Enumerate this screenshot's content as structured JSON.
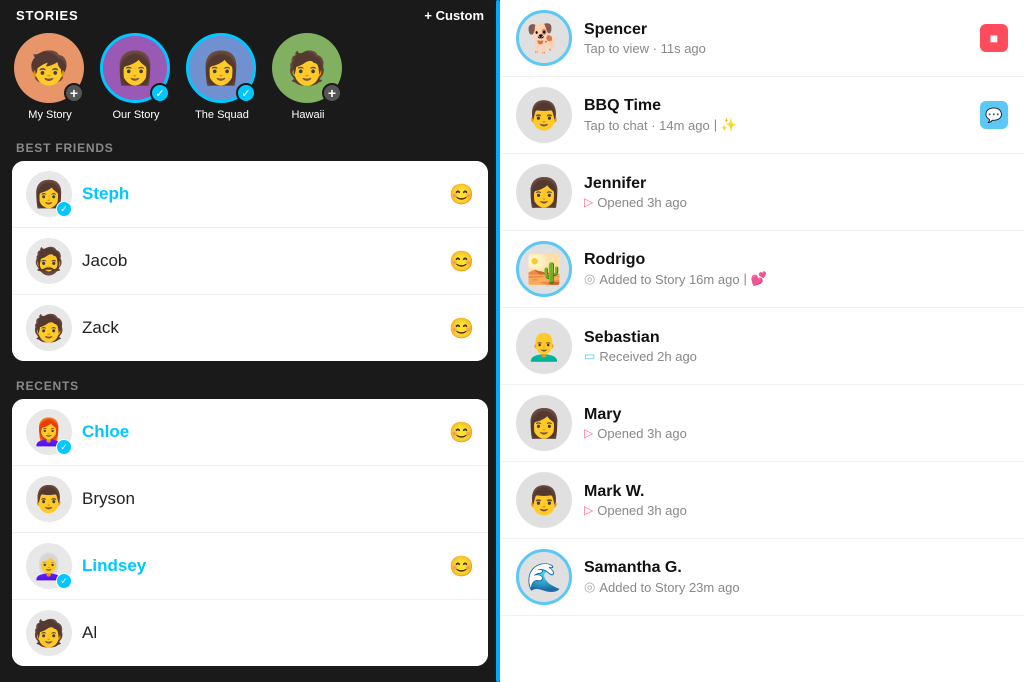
{
  "left": {
    "stories_title": "STORIES",
    "custom_label": "+ Custom",
    "stories": [
      {
        "id": "my-story",
        "label": "My Story",
        "emoji": "🧒",
        "has_ring": false,
        "has_add": true,
        "bg": "av-my-story"
      },
      {
        "id": "our-story",
        "label": "Our Story",
        "emoji": "👩",
        "has_ring": true,
        "has_check": true,
        "bg": "av-our-story"
      },
      {
        "id": "squad",
        "label": "The Squad",
        "emoji": "👩‍🦱",
        "has_ring": true,
        "has_check": true,
        "bg": "av-squad"
      },
      {
        "id": "hawaii",
        "label": "Hawaii",
        "emoji": "🧑",
        "has_ring": false,
        "has_add": true,
        "bg": "av-hawaii"
      }
    ],
    "best_friends_label": "BEST FRIENDS",
    "best_friends": [
      {
        "name": "Steph",
        "emoji": "👩",
        "selected": true,
        "has_check": true,
        "badge": "😊"
      },
      {
        "name": "Jacob",
        "emoji": "🧔",
        "selected": false,
        "has_check": false,
        "badge": "😊"
      },
      {
        "name": "Zack",
        "emoji": "🧑",
        "selected": false,
        "has_check": false,
        "badge": "😊"
      }
    ],
    "recents_label": "RECENTS",
    "recents": [
      {
        "name": "Chloe",
        "emoji": "👩‍🦰",
        "selected": true,
        "has_check": true,
        "badge": "😊"
      },
      {
        "name": "Bryson",
        "emoji": "👨",
        "selected": false,
        "has_check": false,
        "badge": null
      },
      {
        "name": "Lindsey",
        "emoji": "👩‍🦳",
        "selected": true,
        "has_check": true,
        "badge": "😊"
      },
      {
        "name": "Al",
        "emoji": "🧑",
        "selected": false,
        "has_check": false,
        "badge": null
      }
    ]
  },
  "right": {
    "chats": [
      {
        "name": "Spencer",
        "sub": "Tap to view · 11s ago",
        "sub_type": "gray",
        "emoji": "🐕",
        "ring": "blue",
        "badge_type": "red",
        "badge_icon": "■"
      },
      {
        "name": "BBQ Time",
        "sub": "Tap to chat · 14m ago",
        "sub_extra": "✨",
        "sub_type": "gray",
        "emoji": "🧑",
        "ring": "none",
        "badge_type": "blue",
        "badge_icon": "💬"
      },
      {
        "name": "Jennifer",
        "sub": "Opened 3h ago",
        "sub_type": "pink",
        "emoji": "👩",
        "ring": "none",
        "badge_type": "none",
        "badge_icon": ""
      },
      {
        "name": "Rodrigo",
        "sub": "Added to Story 16m ago",
        "sub_extra": "💕",
        "sub_type": "gray-ring",
        "emoji": "🏜️",
        "ring": "blue",
        "badge_type": "none",
        "badge_icon": ""
      },
      {
        "name": "Sebastian",
        "sub": "Received 2h ago",
        "sub_type": "blue",
        "emoji": "👨‍🦲",
        "ring": "none",
        "badge_type": "none",
        "badge_icon": ""
      },
      {
        "name": "Mary",
        "sub": "Opened 3h ago",
        "sub_type": "pink",
        "emoji": "👩",
        "ring": "none",
        "badge_type": "none",
        "badge_icon": ""
      },
      {
        "name": "Mark W.",
        "sub": "Opened 3h ago",
        "sub_type": "pink",
        "emoji": "👨",
        "ring": "none",
        "badge_type": "none",
        "badge_icon": ""
      },
      {
        "name": "Samantha G.",
        "sub": "Added to Story 23m ago",
        "sub_type": "gray-ring",
        "emoji": "🌊",
        "ring": "blue",
        "badge_type": "none",
        "badge_icon": ""
      }
    ]
  }
}
